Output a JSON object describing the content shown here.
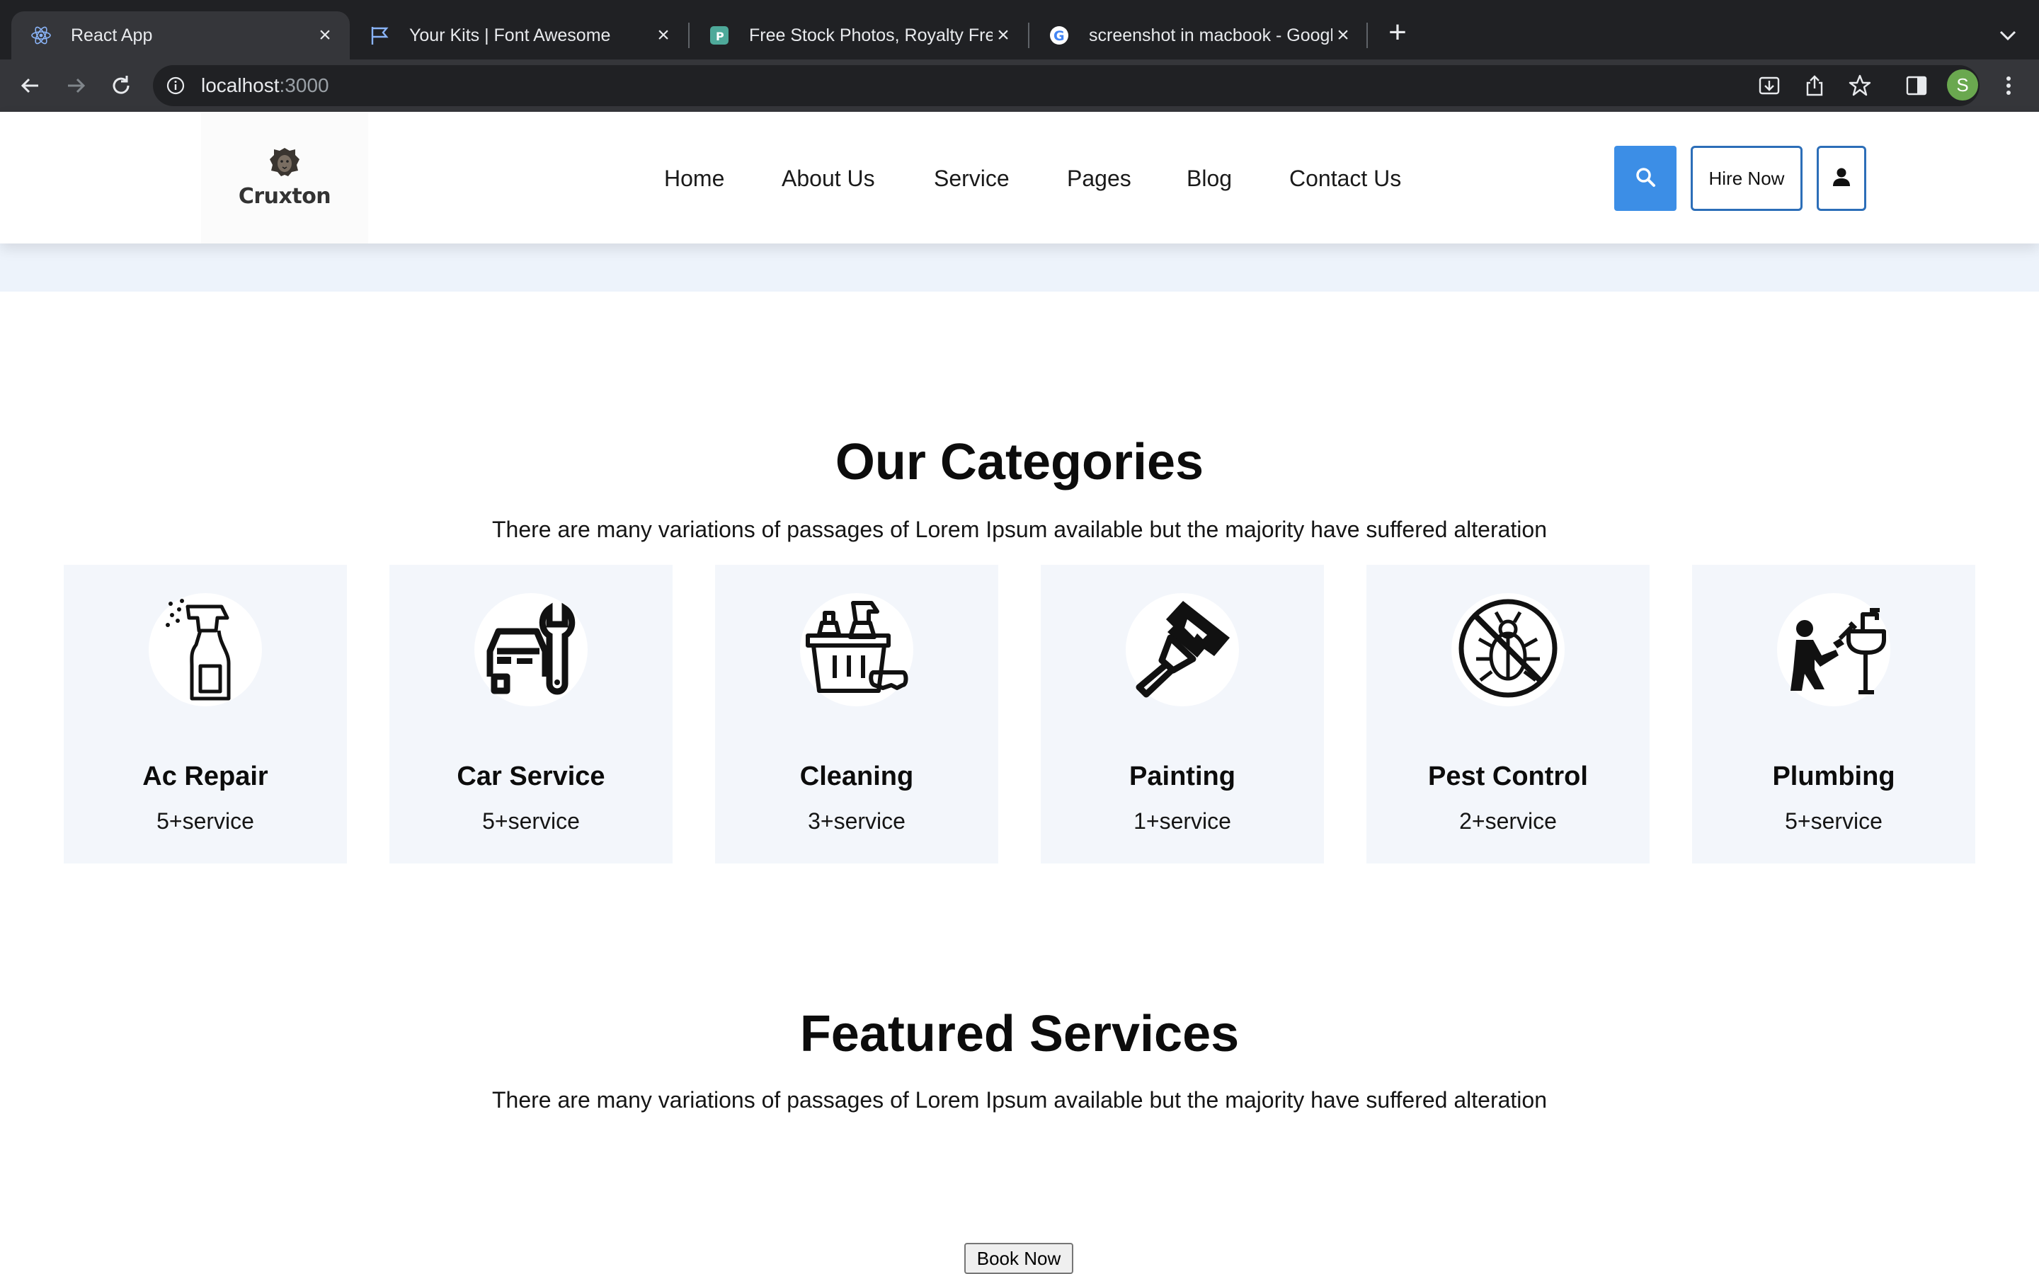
{
  "browser": {
    "tabs": [
      {
        "title": "React App",
        "icon": "react-icon"
      },
      {
        "title": "Your Kits | Font Awesome",
        "icon": "flag-icon"
      },
      {
        "title": "Free Stock Photos, Royalty Free",
        "icon": "pexels-icon"
      },
      {
        "title": "screenshot in macbook - Google",
        "icon": "google-icon"
      }
    ],
    "url_host": "localhost",
    "url_port": ":3000",
    "profile_initial": "S"
  },
  "header": {
    "logo_text": "Cruxton",
    "nav": [
      "Home",
      "About Us",
      "Service",
      "Pages",
      "Blog",
      "Contact Us"
    ],
    "hire_label": "Hire Now",
    "accent": "#3c8ee6"
  },
  "categories": {
    "title": "Our Categories",
    "subtitle": "There are many variations of passages of Lorem Ipsum available but the majority have suffered alteration",
    "items": [
      {
        "name": "Ac Repair",
        "count": "5+service",
        "icon": "spray-bottle-icon"
      },
      {
        "name": "Car Service",
        "count": "5+service",
        "icon": "car-wrench-icon"
      },
      {
        "name": "Cleaning",
        "count": "3+service",
        "icon": "cleaning-bucket-icon"
      },
      {
        "name": "Painting",
        "count": "1+service",
        "icon": "paint-brush-icon"
      },
      {
        "name": "Pest Control",
        "count": "2+service",
        "icon": "no-bug-icon"
      },
      {
        "name": "Plumbing",
        "count": "5+service",
        "icon": "plumber-icon"
      }
    ]
  },
  "featured": {
    "title": "Featured Services",
    "subtitle": "There are many variations of passages of Lorem Ipsum available but the majority have suffered alteration",
    "book_label": "Book Now"
  }
}
